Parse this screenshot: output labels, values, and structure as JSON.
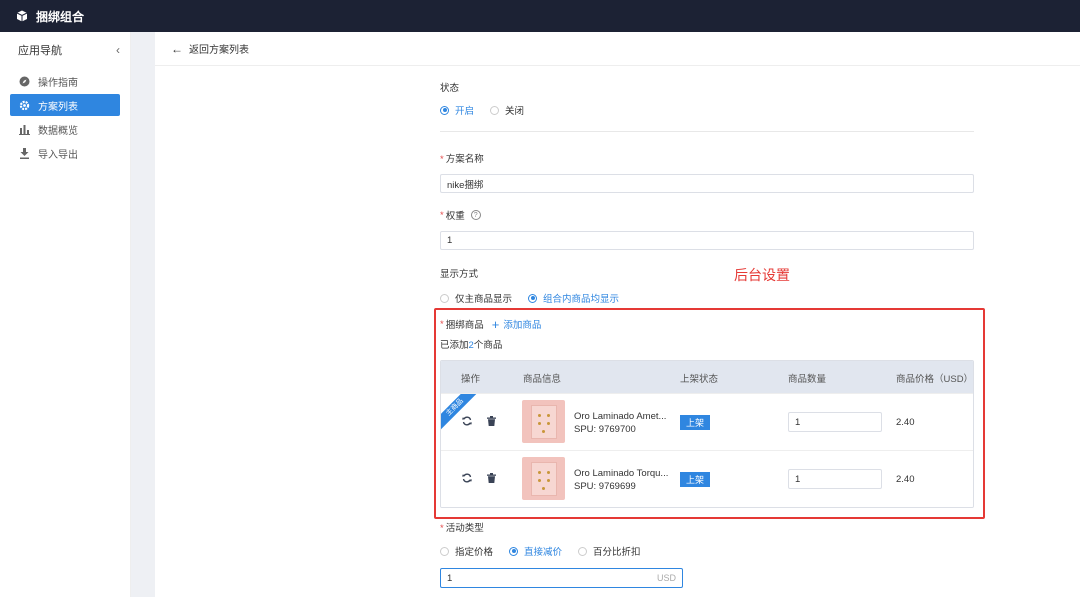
{
  "topbar": {
    "title": "捆绑组合",
    "logo_icon": "cube-icon"
  },
  "sidebar": {
    "header": "应用导航",
    "collapse_icon": "chevron-left-icon",
    "items": [
      {
        "label": "操作指南",
        "icon": "compass-icon",
        "active": false
      },
      {
        "label": "方案列表",
        "icon": "gear-icon",
        "active": true
      },
      {
        "label": "数据概览",
        "icon": "bar-chart-icon",
        "active": false
      },
      {
        "label": "导入导出",
        "icon": "download-icon",
        "active": false
      }
    ]
  },
  "back": {
    "label": "返回方案列表",
    "icon": "arrow-left-icon"
  },
  "form": {
    "status": {
      "label": "状态",
      "options": [
        "开启",
        "关闭"
      ],
      "selected": "开启"
    },
    "name": {
      "label": "方案名称",
      "value": "nike捆绑"
    },
    "weight": {
      "label": "权重",
      "value": "1",
      "help_icon": "question-circle-icon"
    },
    "display": {
      "label": "显示方式",
      "options": [
        "仅主商品显示",
        "组合内商品均显示"
      ],
      "selected": "组合内商品均显示"
    },
    "bundle": {
      "label": "捆绑商品",
      "add_label": "添加商品",
      "count_prefix": "已添加",
      "count_num": "2",
      "count_suffix": "个商品",
      "columns": [
        "操作",
        "商品信息",
        "上架状态",
        "商品数量",
        "商品价格（USD）"
      ],
      "main_tag": "主商品",
      "rows": [
        {
          "name": "Oro Laminado Amet...",
          "spu": "SPU: 9769700",
          "status": "上架",
          "qty": "1",
          "price": "2.40"
        },
        {
          "name": "Oro Laminado Torqu...",
          "spu": "SPU: 9769699",
          "status": "上架",
          "qty": "1",
          "price": "2.40"
        }
      ]
    },
    "activity": {
      "label": "活动类型",
      "options": [
        "指定价格",
        "直接减价",
        "百分比折扣"
      ],
      "selected": "直接减价",
      "value": "1",
      "unit": "USD"
    }
  },
  "annotation": "后台设置",
  "colors": {
    "accent": "#2f86e0",
    "topbar": "#1c2234",
    "annotation": "#e53935"
  }
}
